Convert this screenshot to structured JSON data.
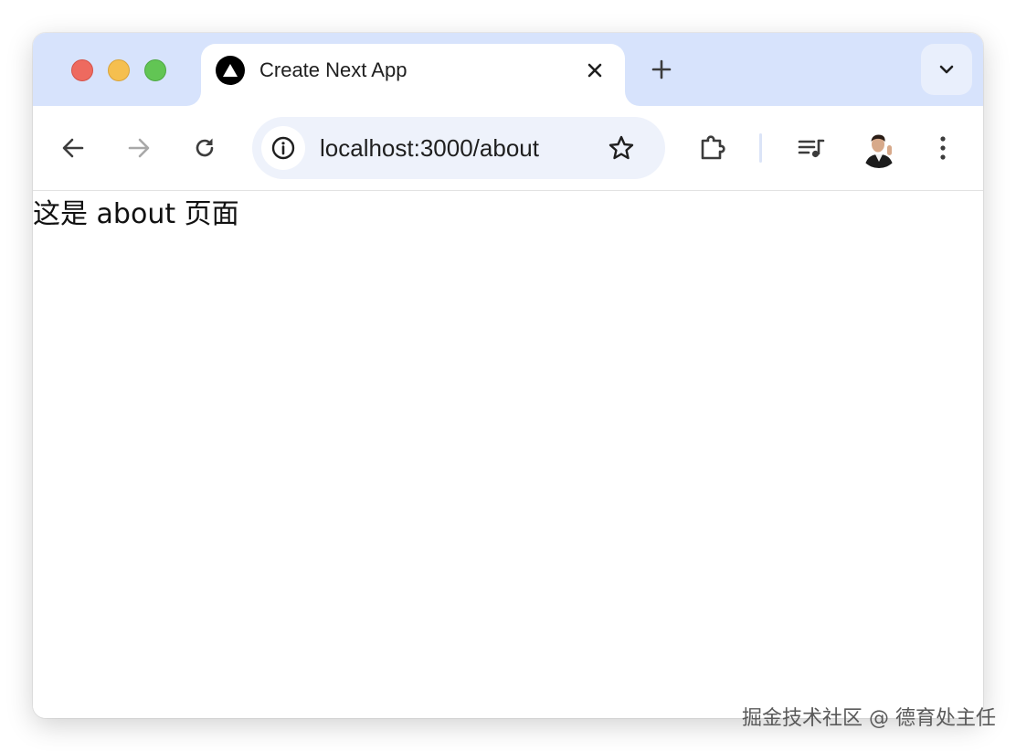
{
  "window": {
    "traffic_lights": [
      "close",
      "minimize",
      "zoom"
    ]
  },
  "tab": {
    "title": "Create Next App",
    "favicon": "nextjs-triangle-icon"
  },
  "tabstrip": {
    "new_tab_icon": "plus-icon",
    "tab_search_icon": "chevron-down-icon"
  },
  "toolbar": {
    "back_icon": "arrow-left-icon",
    "forward_icon": "arrow-right-icon",
    "reload_icon": "reload-icon",
    "site_info_icon": "info-icon",
    "url": "localhost:3000/about",
    "bookmark_icon": "star-icon",
    "extensions_icon": "puzzle-icon",
    "media_icon": "playlist-icon",
    "menu_icon": "kebab-menu-icon"
  },
  "page": {
    "text": "这是 about 页面"
  },
  "watermark": {
    "text": "掘金技术社区 @ 德育处主任"
  },
  "colors": {
    "tabstrip_bg": "#d7e3fc",
    "omnibox_bg": "#eef2fb",
    "red": "#ee6a5f",
    "yellow": "#f5bf4f",
    "green": "#62c554"
  }
}
